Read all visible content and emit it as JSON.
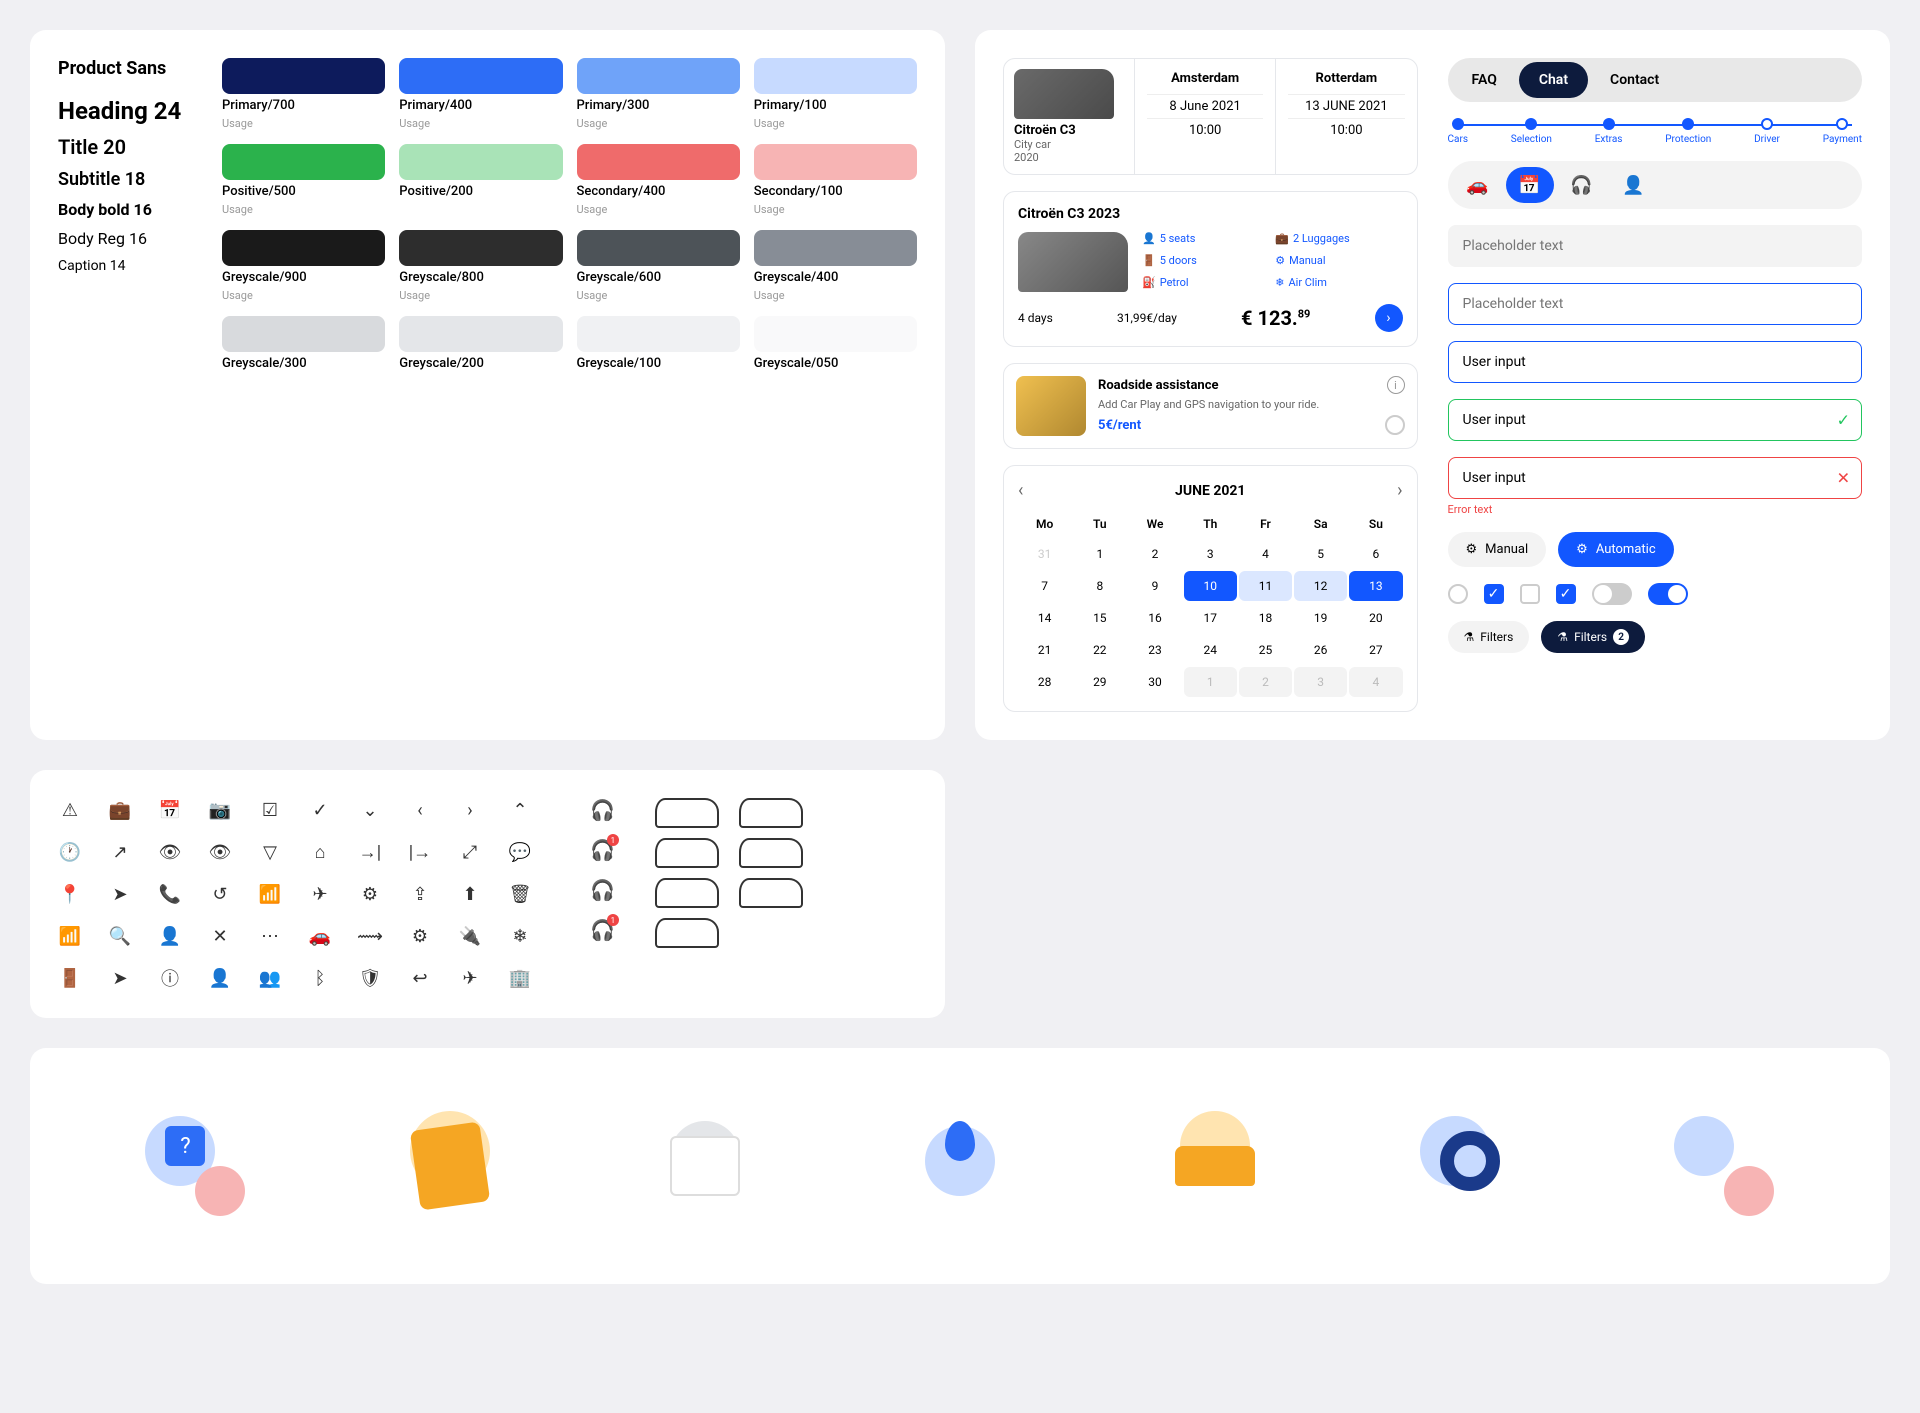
{
  "typography": {
    "title": "Product Sans",
    "h24": "Heading 24",
    "t20": "Title 20",
    "s18": "Subtitle 18",
    "bb16": "Body bold 16",
    "br16": "Body Reg 16",
    "c14": "Caption 14"
  },
  "colors": [
    {
      "name": "Primary/700",
      "hex": "#0d1b5c",
      "use": "Usage"
    },
    {
      "name": "Primary/400",
      "hex": "#2d6df6",
      "use": "Usage"
    },
    {
      "name": "Primary/300",
      "hex": "#6fa3f9",
      "use": "Usage"
    },
    {
      "name": "Primary/100",
      "hex": "#c7daff",
      "use": "Usage"
    },
    {
      "name": "Positive/500",
      "hex": "#2bb24c",
      "use": "Usage"
    },
    {
      "name": "Positive/200",
      "hex": "#a9e3b7",
      "use": ""
    },
    {
      "name": "Secondary/400",
      "hex": "#ef6b6b",
      "use": "Usage"
    },
    {
      "name": "Secondary/100",
      "hex": "#f7b4b4",
      "use": "Usage"
    },
    {
      "name": "Greyscale/900",
      "hex": "#1a1a1a",
      "use": "Usage"
    },
    {
      "name": "Greyscale/800",
      "hex": "#2d2d2d",
      "use": "Usage"
    },
    {
      "name": "Greyscale/600",
      "hex": "#4d5358",
      "use": "Usage"
    },
    {
      "name": "Greyscale/400",
      "hex": "#878d96",
      "use": "Usage"
    },
    {
      "name": "Greyscale/300",
      "hex": "#d8dadd",
      "use": ""
    },
    {
      "name": "Greyscale/200",
      "hex": "#e4e6e9",
      "use": ""
    },
    {
      "name": "Greyscale/100",
      "hex": "#f0f1f3",
      "use": ""
    },
    {
      "name": "Greyscale/050",
      "hex": "#f9f9fa",
      "use": ""
    }
  ],
  "booking": {
    "car_name": "Citroën C3",
    "car_type": "City car",
    "car_year": "2020",
    "from_city": "Amsterdam",
    "to_city": "Rotterdam",
    "from_date": "8 June 2021",
    "to_date": "13 JUNE 2021",
    "from_time": "10:00",
    "to_time": "10:00"
  },
  "car_card": {
    "title": "Citroën C3 2023",
    "specs": [
      "5 seats",
      "2 Luggages",
      "5 doors",
      "Manual",
      "Petrol",
      "Air Clim"
    ],
    "duration": "4 days",
    "rate": "31,99€/day",
    "price": "€ 123.",
    "price_cents": "89"
  },
  "addon": {
    "title": "Roadside assistance",
    "desc": "Add Car Play and GPS navigation to your ride.",
    "price": "5€/rent"
  },
  "calendar": {
    "month": "JUNE 2021",
    "dow": [
      "Mo",
      "Tu",
      "We",
      "Th",
      "Fr",
      "Sa",
      "Su"
    ]
  },
  "tabs": [
    "FAQ",
    "Chat",
    "Contact"
  ],
  "steps": [
    "Cars",
    "Selection",
    "Extras",
    "Protection",
    "Driver",
    "Payment"
  ],
  "inputs": {
    "ph1": "Placeholder text",
    "ph2": "Placeholder text",
    "val1": "User input",
    "val2": "User input",
    "val3": "User input",
    "err": "Error text"
  },
  "segments": {
    "manual": "Manual",
    "auto": "Automatic"
  },
  "filters": {
    "label": "Filters",
    "count": "2"
  }
}
